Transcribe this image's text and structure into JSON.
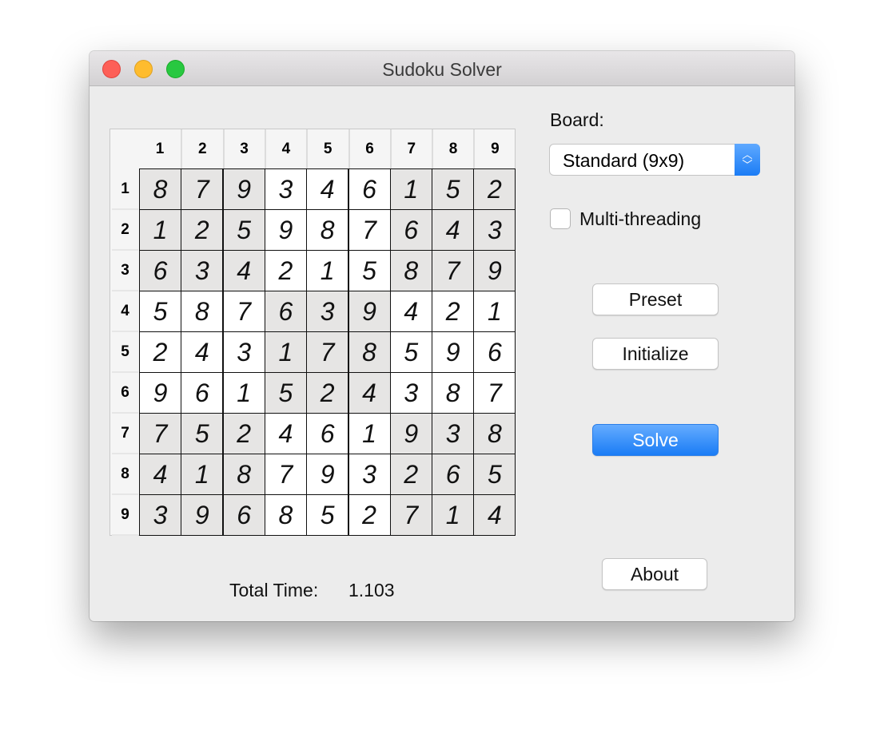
{
  "window": {
    "title": "Sudoku Solver"
  },
  "colors": {
    "close": "#fd5f57",
    "minimize": "#febc2e",
    "zoom": "#28c840",
    "shaded_cell": "#e6e5e4",
    "accent": "#1a7cf5"
  },
  "grid": {
    "column_headers": [
      "1",
      "2",
      "3",
      "4",
      "5",
      "6",
      "7",
      "8",
      "9"
    ],
    "row_headers": [
      "1",
      "2",
      "3",
      "4",
      "5",
      "6",
      "7",
      "8",
      "9"
    ],
    "rows": [
      [
        "8",
        "7",
        "9",
        "3",
        "4",
        "6",
        "1",
        "5",
        "2"
      ],
      [
        "1",
        "2",
        "5",
        "9",
        "8",
        "7",
        "6",
        "4",
        "3"
      ],
      [
        "6",
        "3",
        "4",
        "2",
        "1",
        "5",
        "8",
        "7",
        "9"
      ],
      [
        "5",
        "8",
        "7",
        "6",
        "3",
        "9",
        "4",
        "2",
        "1"
      ],
      [
        "2",
        "4",
        "3",
        "1",
        "7",
        "8",
        "5",
        "9",
        "6"
      ],
      [
        "9",
        "6",
        "1",
        "5",
        "2",
        "4",
        "3",
        "8",
        "7"
      ],
      [
        "7",
        "5",
        "2",
        "4",
        "6",
        "1",
        "9",
        "3",
        "8"
      ],
      [
        "4",
        "1",
        "8",
        "7",
        "9",
        "3",
        "2",
        "6",
        "5"
      ],
      [
        "3",
        "9",
        "6",
        "8",
        "5",
        "2",
        "7",
        "1",
        "4"
      ]
    ]
  },
  "board": {
    "label": "Board:",
    "selected": "Standard (9x9)"
  },
  "multithreading": {
    "label": "Multi-threading",
    "checked": false
  },
  "buttons": {
    "preset": "Preset",
    "initialize": "Initialize",
    "solve": "Solve",
    "about": "About"
  },
  "status": {
    "label": "Total Time:",
    "value": "1.103"
  }
}
